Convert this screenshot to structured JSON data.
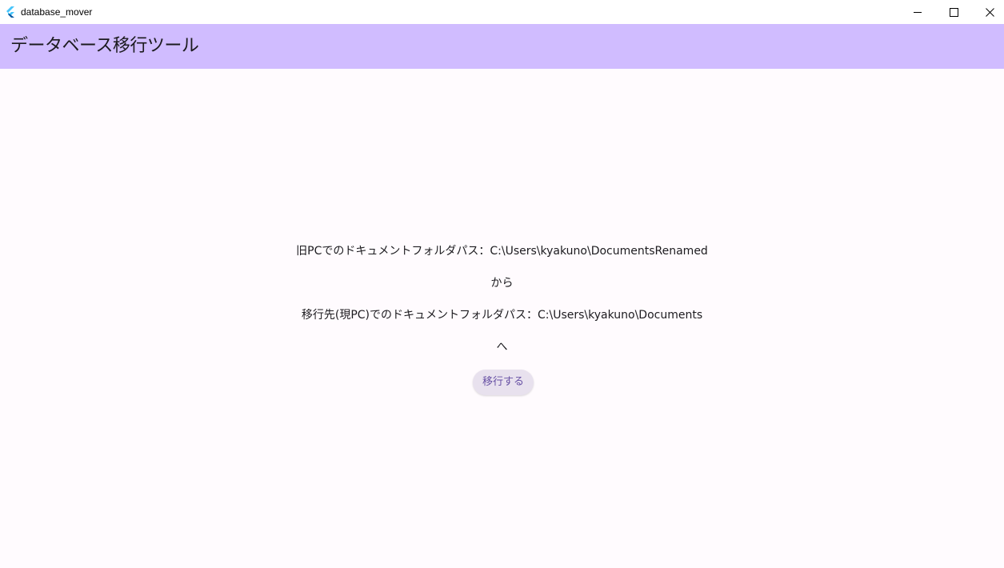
{
  "window": {
    "title": "database_mover",
    "icon": "flutter-icon",
    "controls": {
      "minimize_icon": "minimize-icon",
      "maximize_icon": "maximize-icon",
      "close_icon": "close-icon"
    }
  },
  "appbar": {
    "title": "データベース移行ツール",
    "color": "#d0bcff"
  },
  "main": {
    "old_path_line": "旧PCでのドキュメントフォルダパス：C:\\Users\\kyakuno\\DocumentsRenamed",
    "from_label": "から",
    "new_path_line": "移行先(現PC)でのドキュメントフォルダパス：C:\\Users\\kyakuno\\Documents",
    "to_label": "へ",
    "migrate_button_label": "移行する"
  },
  "colors": {
    "background": "#fffbfe",
    "accent": "#6750a4",
    "button_bg": "#e8e1ee"
  }
}
